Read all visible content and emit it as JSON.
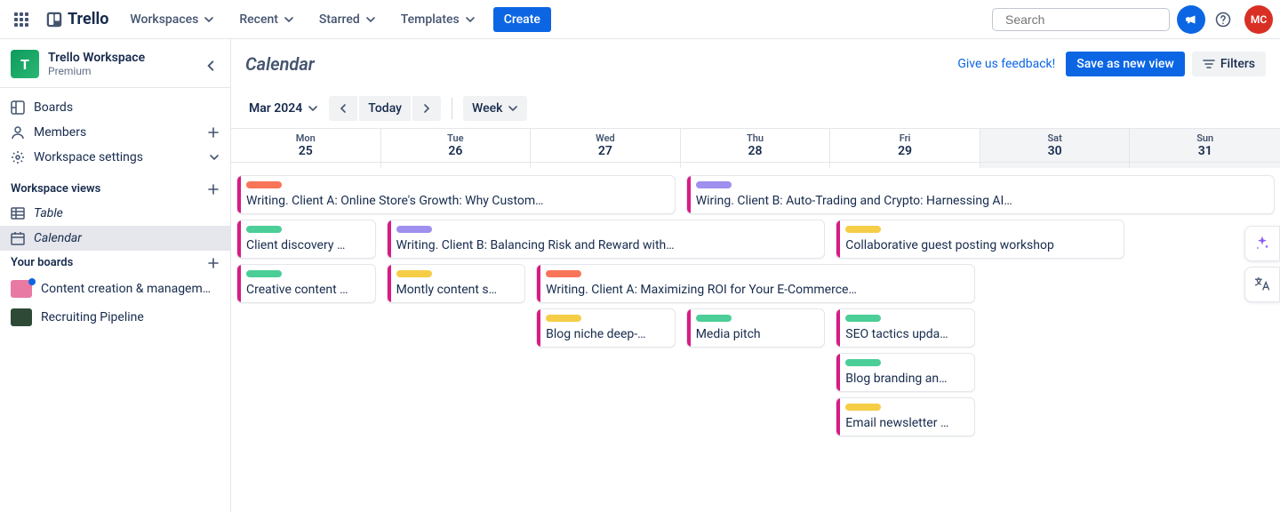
{
  "header": {
    "brand": "Trello",
    "nav": [
      "Workspaces",
      "Recent",
      "Starred",
      "Templates"
    ],
    "create": "Create",
    "search_placeholder": "Search",
    "avatar_initials": "MC"
  },
  "sidebar": {
    "workspace": {
      "initial": "T",
      "name": "Trello Workspace",
      "plan": "Premium"
    },
    "primary": [
      {
        "label": "Boards",
        "icon": "board"
      },
      {
        "label": "Members",
        "icon": "members",
        "trail": "plus"
      },
      {
        "label": "Workspace settings",
        "icon": "gear",
        "trail": "chevron-down"
      }
    ],
    "views_head": "Workspace views",
    "views": [
      {
        "label": "Table",
        "icon": "table"
      },
      {
        "label": "Calendar",
        "icon": "calendar",
        "active": true
      }
    ],
    "boards_head": "Your boards",
    "boards": [
      {
        "label": "Content creation & managem…",
        "color": "#e879a3",
        "unread": true
      },
      {
        "label": "Recruiting Pipeline",
        "color": "#2e4a36"
      }
    ]
  },
  "main": {
    "title": "Calendar",
    "feedback": "Give us feedback!",
    "save": "Save as new view",
    "filters": "Filters",
    "month": "Mar 2024",
    "today": "Today",
    "range": "Week"
  },
  "days": [
    {
      "dow": "Mon",
      "num": "25"
    },
    {
      "dow": "Tue",
      "num": "26"
    },
    {
      "dow": "Wed",
      "num": "27"
    },
    {
      "dow": "Thu",
      "num": "28"
    },
    {
      "dow": "Fri",
      "num": "29"
    },
    {
      "dow": "Sat",
      "num": "30",
      "weekend": true
    },
    {
      "dow": "Sun",
      "num": "31",
      "weekend": true
    }
  ],
  "events": [
    {
      "row": 0,
      "start": 0,
      "span": 3,
      "text": "Writing. Client A: Online Store's Growth: Why Custom…",
      "pill": "#f87559"
    },
    {
      "row": 0,
      "start": 3,
      "span": 4,
      "text": "Wiring. Client B: Auto-Trading and Crypto: Harnessing AI…",
      "pill": "#9f8fef"
    },
    {
      "row": 1,
      "start": 0,
      "span": 1,
      "text": "Client discovery …",
      "pill": "#4bce97"
    },
    {
      "row": 1,
      "start": 1,
      "span": 3,
      "text": "Writing. Client B: Balancing Risk and Reward with…",
      "pill": "#9f8fef"
    },
    {
      "row": 1,
      "start": 4,
      "span": 2,
      "text": "Collaborative guest posting workshop",
      "pill": "#f5cd47"
    },
    {
      "row": 2,
      "start": 0,
      "span": 1,
      "text": "Creative content …",
      "pill": "#4bce97"
    },
    {
      "row": 2,
      "start": 1,
      "span": 1,
      "text": "Montly content s…",
      "pill": "#f5cd47"
    },
    {
      "row": 2,
      "start": 2,
      "span": 3,
      "text": "Writing. Client A: Maximizing ROI for Your E-Commerce…",
      "pill": "#f87559"
    },
    {
      "row": 3,
      "start": 2,
      "span": 1,
      "text": "Blog niche deep-…",
      "pill": "#f5cd47"
    },
    {
      "row": 3,
      "start": 3,
      "span": 1,
      "text": "Media pitch",
      "pill": "#4bce97"
    },
    {
      "row": 3,
      "start": 4,
      "span": 1,
      "text": "SEO tactics upda…",
      "pill": "#4bce97"
    },
    {
      "row": 4,
      "start": 4,
      "span": 1,
      "text": "Blog branding an…",
      "pill": "#4bce97"
    },
    {
      "row": 5,
      "start": 4,
      "span": 1,
      "text": "Email newsletter …",
      "pill": "#f5cd47"
    }
  ],
  "colors": {
    "accent": "#0c66e4",
    "stripe": "#d91a85"
  }
}
